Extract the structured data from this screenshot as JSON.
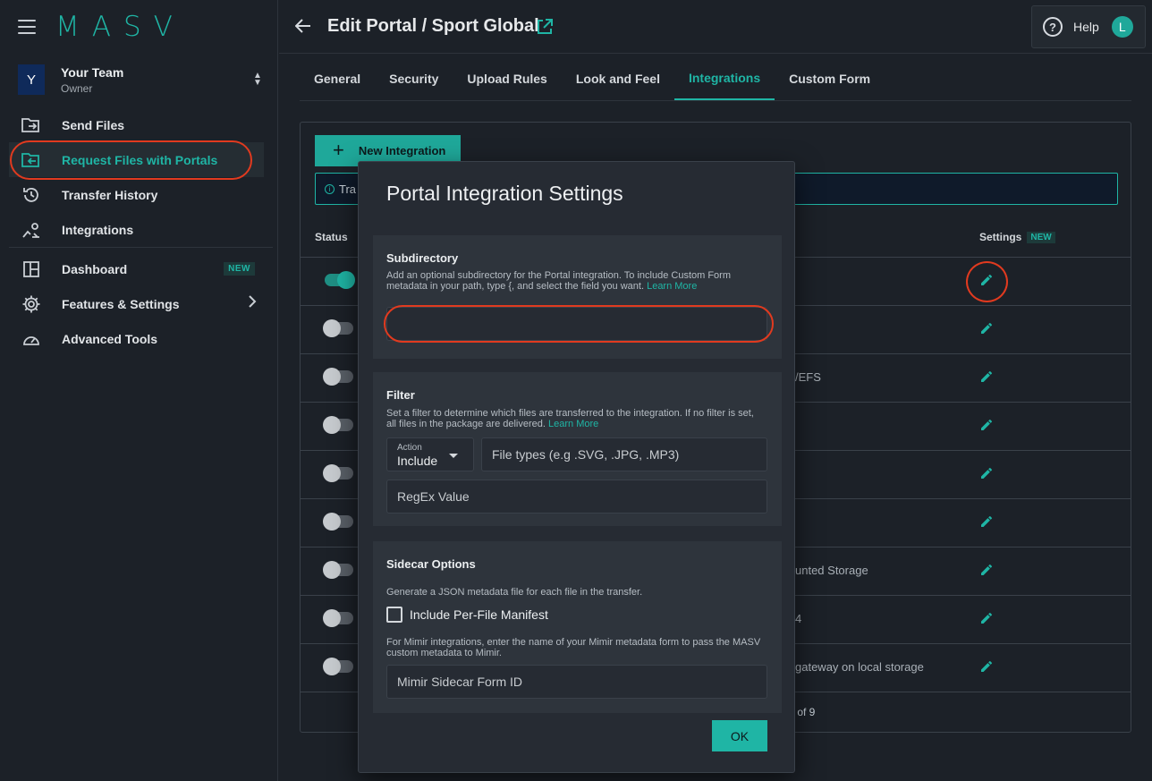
{
  "logo": "MASV",
  "team": {
    "avatar": "Y",
    "name": "Your Team",
    "role": "Owner"
  },
  "nav": [
    {
      "label": "Send Files",
      "icon": "send-files-icon"
    },
    {
      "label": "Request Files with Portals",
      "icon": "request-files-icon",
      "active": true
    },
    {
      "label": "Transfer History",
      "icon": "history-icon"
    },
    {
      "label": "Integrations",
      "icon": "integrations-icon"
    },
    {
      "label": "Dashboard",
      "icon": "dashboard-icon",
      "badge": "NEW"
    },
    {
      "label": "Features & Settings",
      "icon": "gear-icon"
    },
    {
      "label": "Advanced Tools",
      "icon": "gauge-icon"
    }
  ],
  "header": {
    "title": "Edit Portal / Sport Global",
    "help": "Help",
    "user_initial": "L"
  },
  "tabs": [
    "General",
    "Security",
    "Upload Rules",
    "Look and Feel",
    "Integrations",
    "Custom Form"
  ],
  "active_tab": "Integrations",
  "main": {
    "new_integration": "New Integration",
    "info_text": "Tra",
    "col_status": "Status",
    "col_settings": "Settings",
    "settings_badge": "NEW",
    "rows": [
      {
        "on": true,
        "desc": ""
      },
      {
        "on": false,
        "desc": ""
      },
      {
        "on": false,
        "desc": "/EFS"
      },
      {
        "on": false,
        "desc": ""
      },
      {
        "on": false,
        "desc": ""
      },
      {
        "on": false,
        "desc": ""
      },
      {
        "on": false,
        "desc": "unted Storage"
      },
      {
        "on": false,
        "desc": "4"
      },
      {
        "on": false,
        "desc": "gateway on local storage"
      }
    ],
    "pagination": ") of 9"
  },
  "modal": {
    "title": "Portal Integration Settings",
    "subdirectory": {
      "title": "Subdirectory",
      "desc": "Add an optional subdirectory for the Portal integration. To include Custom Form metadata in your path, type {, and select the field you want.",
      "link": "Learn More",
      "value": ""
    },
    "filter": {
      "title": "Filter",
      "desc": "Set a filter to determine which files are transferred to the integration. If no filter is set, all files in the package are delivered.",
      "link": "Learn More",
      "action_label": "Action",
      "action_value": "Include",
      "file_types_placeholder": "File types (e.g .SVG, .JPG, .MP3)",
      "regex_placeholder": "RegEx Value"
    },
    "sidecar": {
      "title": "Sidecar Options",
      "desc": "Generate a JSON metadata file for each file in the transfer.",
      "checkbox_label": "Include Per-File Manifest",
      "mimir_desc": "For Mimir integrations, enter the name of your Mimir metadata form to pass the MASV custom metadata to Mimir.",
      "mimir_placeholder": "Mimir Sidecar Form ID"
    },
    "ok": "OK"
  },
  "colors": {
    "accent": "#1fb5a5",
    "annotation": "#e13a1f",
    "background": "#1c2128"
  }
}
